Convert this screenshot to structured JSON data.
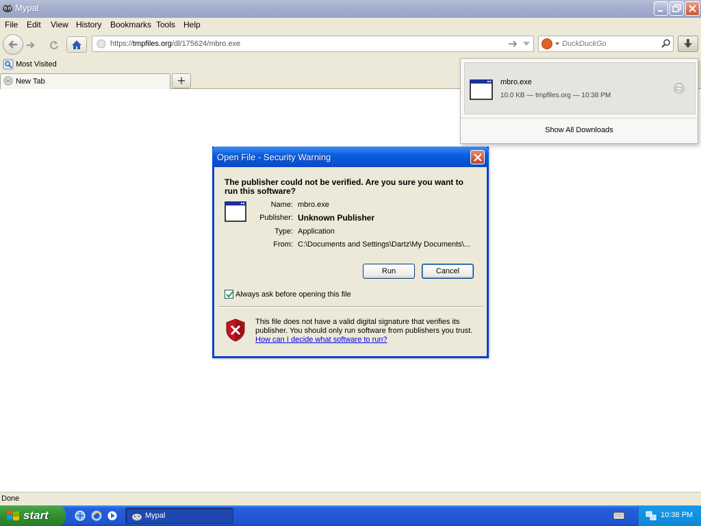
{
  "window": {
    "title": "Mypal"
  },
  "menu": {
    "file": "File",
    "edit": "Edit",
    "view": "View",
    "history": "History",
    "bookmarks": "Bookmarks",
    "tools": "Tools",
    "help": "Help"
  },
  "nav": {
    "url_prefix": "https://",
    "url_domain": "tmpfiles.org",
    "url_path": "/dl/175624/mbro.exe",
    "search_placeholder": "DuckDuckGo"
  },
  "bookmarks": {
    "most_visited": "Most Visited"
  },
  "tabs": {
    "active": "New Tab",
    "new_tab_symbol": "+"
  },
  "downloads": {
    "file_name": "mbro.exe",
    "file_meta": "10.0 KB — tmpfiles.org — 10:38 PM",
    "show_all": "Show All Downloads"
  },
  "dialog": {
    "title": "Open File - Security Warning",
    "question": "The publisher could not be verified.  Are you sure you want to run this software?",
    "name_label": "Name:",
    "name_value": "mbro.exe",
    "publisher_label": "Publisher:",
    "publisher_value": "Unknown Publisher",
    "type_label": "Type:",
    "type_value": "Application",
    "from_label": "From:",
    "from_value": "C:\\Documents and Settings\\Dartz\\My Documents\\...",
    "run_label": "Run",
    "cancel_label": "Cancel",
    "checkbox_label": "Always ask before opening this file",
    "checkbox_checked": true,
    "warning_text": "This file does not have a valid digital signature that verifies its publisher.  You should only run software from publishers you trust.",
    "warning_link": "How can I decide what software to run?"
  },
  "status": {
    "text": "Done"
  },
  "taskbar": {
    "start_label": "start",
    "task_label": "Mypal",
    "clock": "10:38 PM"
  },
  "colors": {
    "dialog_border": "#0b3fd6",
    "taskbar_blue": "#245edb",
    "start_green": "#2f8f2f",
    "link": "#0000ee"
  }
}
